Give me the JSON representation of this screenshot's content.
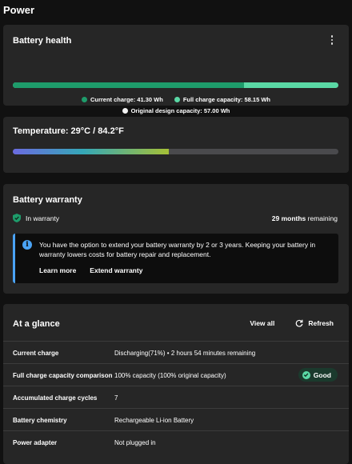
{
  "page": {
    "title": "Power"
  },
  "battery_health": {
    "title": "Battery health",
    "current_charge_fraction": 0.71,
    "legend": {
      "current": "Current charge: 41.30 Wh",
      "full": "Full charge capacity: 58.15 Wh",
      "original": "Original design capacity: 57.00 Wh"
    }
  },
  "temperature": {
    "title": "Temperature:  29°C / 84.2°F",
    "level_fraction": 0.48
  },
  "warranty": {
    "title": "Battery warranty",
    "status": "In warranty",
    "remaining_value": "29 months",
    "remaining_suffix": "remaining",
    "info_text": "You have the option to extend your battery warranty by 2 or 3 years. Keeping your battery in warranty lowers costs for battery repair and replacement.",
    "learn_more": "Learn more",
    "extend": "Extend warranty"
  },
  "glance": {
    "title": "At a glance",
    "view_all": "View all",
    "refresh": "Refresh",
    "rows": [
      {
        "label": "Current charge",
        "value": "Discharging(71%)  •  2 hours 54 minutes remaining"
      },
      {
        "label": "Full charge capacity comparison",
        "value": "100% capacity (100% original capacity)",
        "badge": "Good"
      },
      {
        "label": "Accumulated charge cycles",
        "value": "7"
      },
      {
        "label": "Battery chemistry",
        "value": "Rechargeable Li-ion Battery"
      },
      {
        "label": "Power adapter",
        "value": "Not plugged in"
      }
    ]
  },
  "colors": {
    "background": "#111111",
    "card": "#262626",
    "charge_dark": "#1e9c6b",
    "charge_light": "#5ad8a5",
    "info_accent": "#4aa3f5"
  }
}
